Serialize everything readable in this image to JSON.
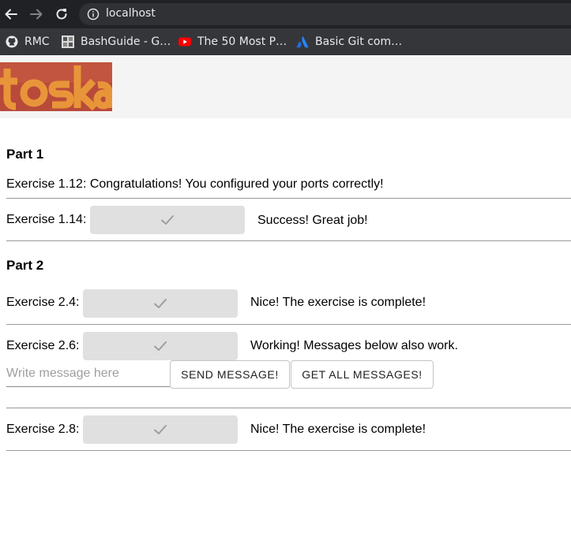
{
  "browser": {
    "url": "localhost",
    "bookmarks": [
      {
        "label": "RMC",
        "icon": "github-icon"
      },
      {
        "label": "BashGuide - G…",
        "icon": "bashguide-favicon-icon"
      },
      {
        "label": "The 50 Most P…",
        "icon": "youtube-icon"
      },
      {
        "label": "Basic Git com…",
        "icon": "atlassian-icon"
      }
    ]
  },
  "logo": {
    "text": "toska",
    "colors": {
      "orange": "#e8953a",
      "red": "#b84a3a"
    }
  },
  "part1": {
    "title": "Part 1",
    "ex112": {
      "text": "Exercise 1.12: Congratulations! You configured your ports correctly!"
    },
    "ex114": {
      "label": "Exercise 1.14:",
      "status": "Success! Great job!"
    }
  },
  "part2": {
    "title": "Part 2",
    "ex24": {
      "label": "Exercise 2.4:",
      "status": "Nice! The exercise is complete!"
    },
    "ex26": {
      "label": "Exercise 2.6:",
      "status": "Working! Messages below also work.",
      "input_placeholder": "Write message here",
      "input_value": "",
      "send_label": "SEND MESSAGE!",
      "get_all_label": "GET ALL MESSAGES!"
    },
    "ex28": {
      "label": "Exercise 2.8:",
      "status": "Nice! The exercise is complete!"
    }
  },
  "colors": {
    "chrome_dark": "#202124",
    "bookmarks_bar": "#35363a",
    "button_fill": "#e0e0e0",
    "checkmark": "#9e9e9e"
  }
}
